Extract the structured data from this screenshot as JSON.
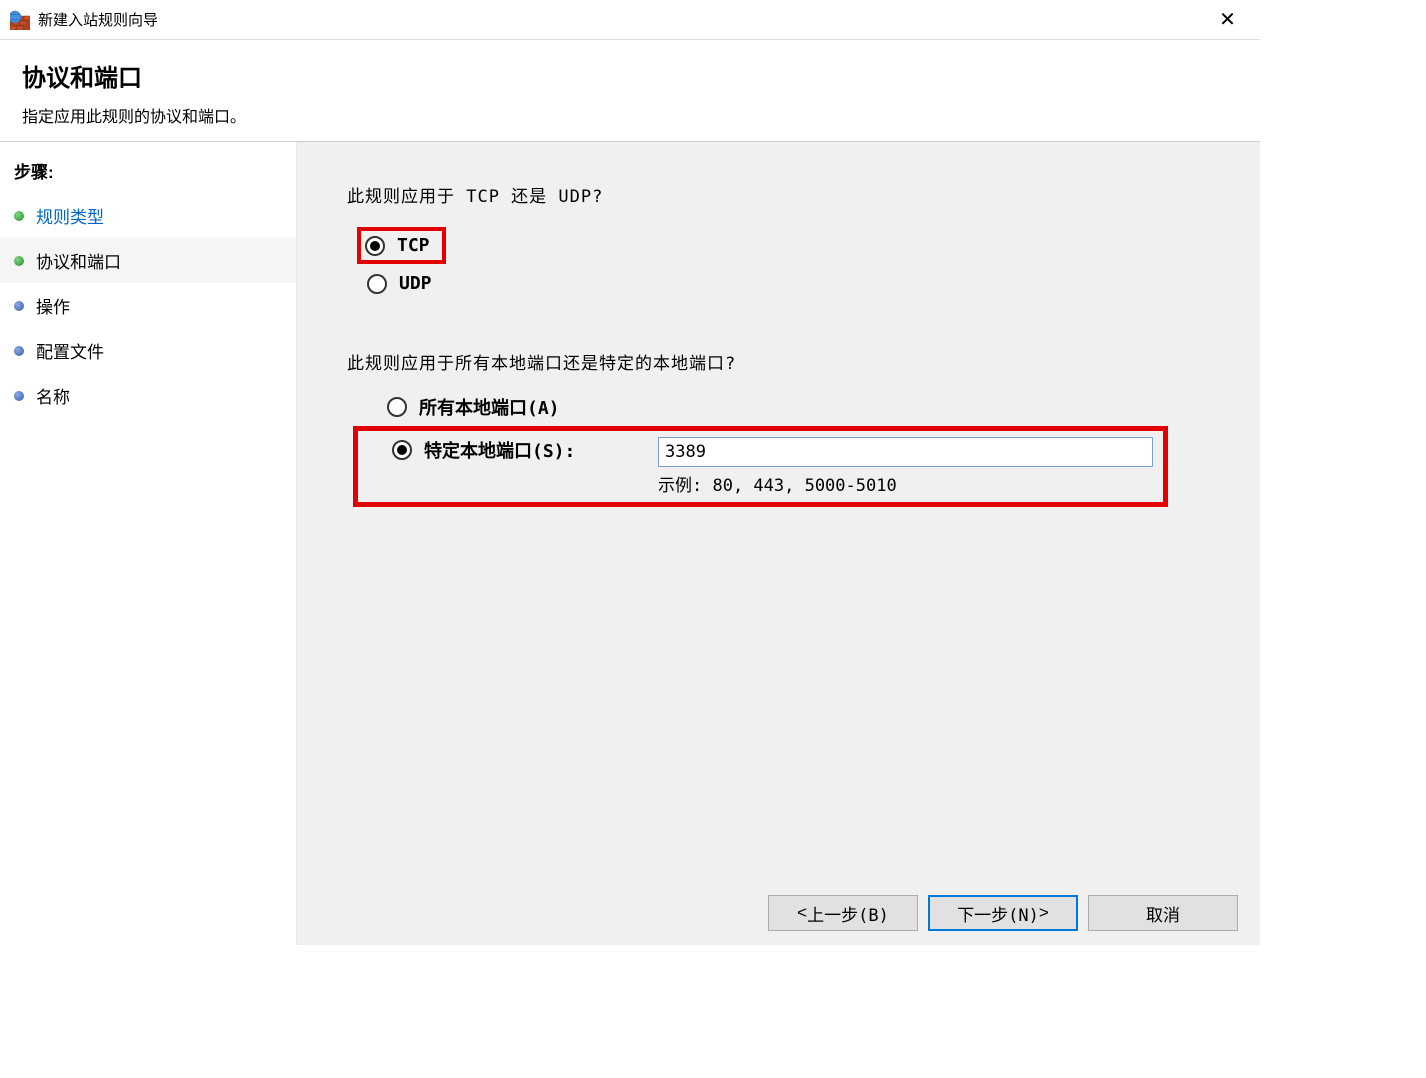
{
  "window": {
    "title": "新建入站规则向导"
  },
  "header": {
    "title": "协议和端口",
    "subtitle": "指定应用此规则的协议和端口。"
  },
  "sidebar": {
    "header": "步骤:",
    "items": [
      {
        "label": "规则类型",
        "link": true
      },
      {
        "label": "协议和端口",
        "active": true
      },
      {
        "label": "操作"
      },
      {
        "label": "配置文件"
      },
      {
        "label": "名称"
      }
    ]
  },
  "content": {
    "protocolQuestion": "此规则应用于 TCP 还是 UDP?",
    "tcpLabel": "TCP",
    "udpLabel": "UDP",
    "portQuestion": "此规则应用于所有本地端口还是特定的本地端口?",
    "allPortsLabel": "所有本地端口(A)",
    "specificPortsLabel": "特定本地端口(S):",
    "portValue": "3389",
    "exampleText": "示例: 80, 443, 5000-5010"
  },
  "footer": {
    "back": "上一步(B)",
    "next": "下一步(N)",
    "cancel": "取消"
  }
}
